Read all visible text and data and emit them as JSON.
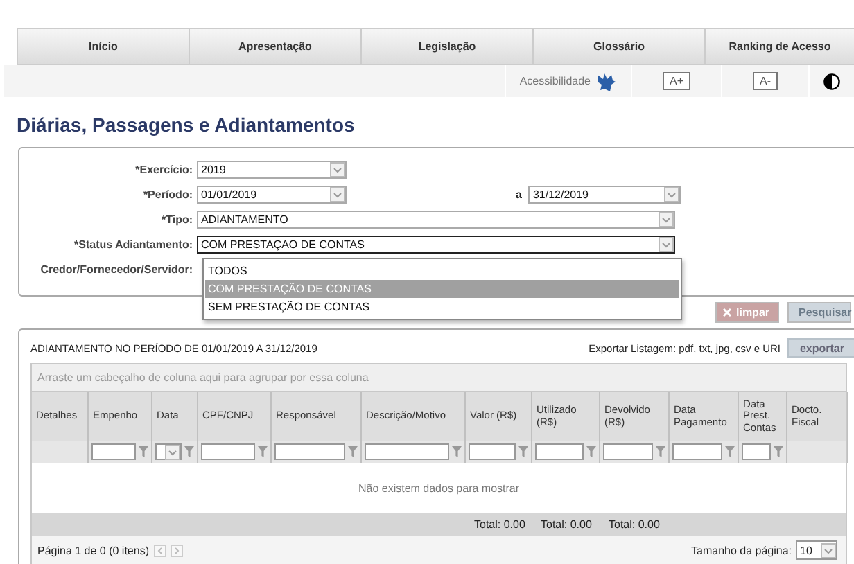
{
  "nav": {
    "items": [
      {
        "label": "Início"
      },
      {
        "label": "Apresentação"
      },
      {
        "label": "Legislação"
      },
      {
        "label": "Glossário"
      },
      {
        "label": "Ranking de Acesso"
      }
    ]
  },
  "accessibility": {
    "label": "Acessibilidade",
    "buttons": [
      "A+",
      "A-"
    ]
  },
  "title": "Diárias, Passagens e Adiantamentos",
  "form": {
    "fields": [
      {
        "kind": "select",
        "label": "*Exercício:",
        "value": "2019"
      },
      {
        "kind": "range",
        "label": "*Período:",
        "value": "01/01/2019",
        "to_label": "a",
        "to_value": "31/12/2019"
      },
      {
        "kind": "wide",
        "label": "*Tipo:",
        "value": "ADIANTAMENTO"
      },
      {
        "kind": "open",
        "label": "*Status Adiantamento:",
        "value": "COM PRESTAÇAO DE CONTAS"
      },
      {
        "kind": "hidden",
        "label": "Credor/Fornecedor/Servidor:"
      }
    ],
    "options": [
      {
        "label": "TODOS",
        "selected": false
      },
      {
        "label": "COM PRESTAÇÃO DE CONTAS",
        "selected": true
      },
      {
        "label": "SEM PRESTAÇÃO DE CONTAS",
        "selected": false
      }
    ],
    "clear_button": "limpar",
    "search_button": "Pesquisar"
  },
  "table": {
    "caption": "ADIANTAMENTO NO PERÍODO DE 01/01/2019 A 31/12/2019",
    "export_label": "Exportar Listagem: pdf, txt, jpg, csv e URI",
    "export_button": "exportar",
    "group_hint": "Arraste um cabeçalho de coluna aqui para agrupar por essa coluna",
    "columns": [
      {
        "label": "Detalhes",
        "kind": "plain"
      },
      {
        "label": "Empenho",
        "kind": "text"
      },
      {
        "label": "Data",
        "kind": "date"
      },
      {
        "label": "CPF/CNPJ",
        "kind": "text"
      },
      {
        "label": "Responsável",
        "kind": "text"
      },
      {
        "label": "Descrição/Motivo",
        "kind": "text"
      },
      {
        "label": "Valor (R$)",
        "kind": "text",
        "total": "Total: 0.00"
      },
      {
        "label": "Utilizado (R$)",
        "kind": "text",
        "total": "Total: 0.00"
      },
      {
        "label": "Devolvido (R$)",
        "kind": "text",
        "total": "Total: 0.00"
      },
      {
        "label": "Data Pagamento",
        "kind": "text"
      },
      {
        "label": "Data Prest. Contas",
        "kind": "text"
      },
      {
        "label": "Docto. Fiscal",
        "kind": "plain"
      }
    ],
    "empty": "Não existem dados para mostrar",
    "pager": "Página 1 de 0 (0 itens)",
    "page_size_label": "Tamanho da página:",
    "page_size": "10"
  }
}
